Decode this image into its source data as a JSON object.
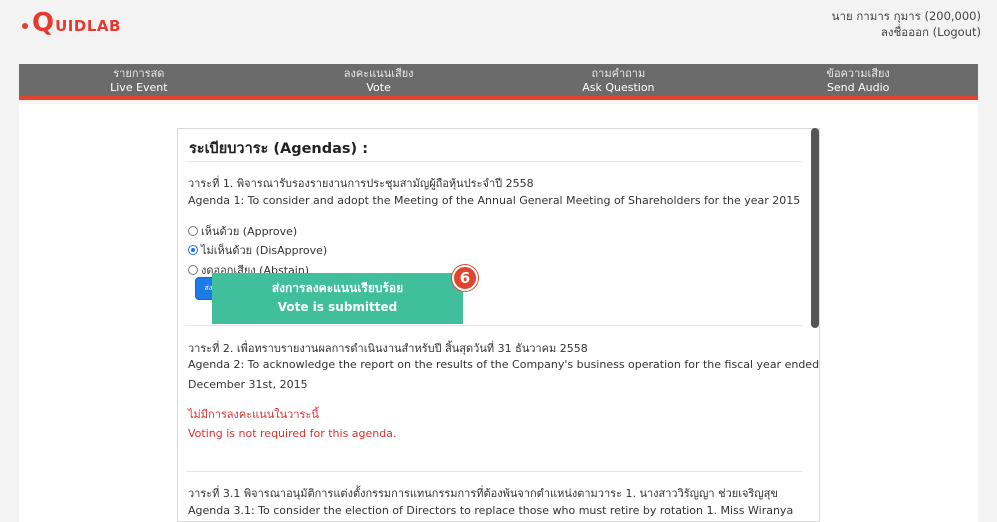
{
  "logo": {
    "q": "Q",
    "rest": "UIDLAB"
  },
  "user": {
    "name": "นาย กามาร กุมาร (200,000)",
    "logout": "ลงชื่อออก (Logout)"
  },
  "nav": [
    {
      "th": "รายการสด",
      "en": "Live Event"
    },
    {
      "th": "ลงคะแนนเสียง",
      "en": "Vote"
    },
    {
      "th": "ถามคำถาม",
      "en": "Ask Question"
    },
    {
      "th": "ข้อความเสียง",
      "en": "Send Audio"
    }
  ],
  "heading": "ระเบียบวาระ (Agendas) :",
  "agenda1": {
    "th": "วาระที่ 1. พิจารณารับรองรายงานการประชุมสามัญผู้ถือหุ้นประจำปี 2558",
    "en": "Agenda 1: To consider and adopt the Meeting of the Annual General Meeting of Shareholders for the year 2015",
    "options": [
      "เห็นด้วย (Approve)",
      "ไม่เห็นด้วย (DisApprove)",
      "งดออกเสียง (Abstain)"
    ],
    "selected_index": 1,
    "send_label": "ส่ง (Send)"
  },
  "agenda2": {
    "th": "วาระที่ 2. เพื่อทราบรายงานผลการดำเนินงานสำหรับปี สิ้นสุดวันที่ 31 ธันวาคม 2558",
    "en_line1": "Agenda 2: To acknowledge the report on the results of the Company's business operation for the fiscal year ended",
    "en_line2": "December 31st, 2015",
    "no_vote_th": "ไม่มีการลงคะแนนในวาระนี้",
    "no_vote_en": "Voting is not required for this agenda.",
    "submitted_th": "ส่งการลงคะแนนเรียบร้อย",
    "submitted_en": "Vote is submitted",
    "badge": "6"
  },
  "agenda3": {
    "th": "วาระที่ 3.1 พิจารณาอนุมัติการแต่งตั้งกรรมการแทนกรรมการที่ต้องพ้นจากตำแหน่งตามวาระ 1. นางสาววิรัญญา ช่วยเจริญสุข",
    "en": "Agenda 3.1: To consider the election of Directors to replace those who must retire by rotation 1. Miss Wiranya"
  },
  "colors": {
    "accent": "#e0462f",
    "nav_bg": "#6b6b6b",
    "submit_bg": "#3fbf9b",
    "send_bg": "#1e7be6"
  }
}
